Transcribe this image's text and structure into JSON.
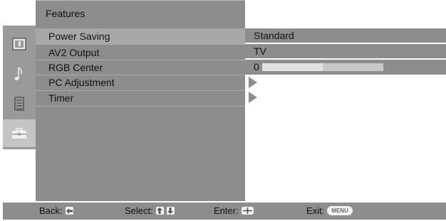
{
  "header": {
    "title": "Features"
  },
  "sidebar": {
    "tabs": [
      {
        "icon": "picture-icon",
        "active": false
      },
      {
        "icon": "music-note-icon",
        "active": false
      },
      {
        "icon": "channel-list-icon",
        "active": false
      },
      {
        "icon": "toolbox-icon",
        "active": true
      }
    ]
  },
  "menu": {
    "items": [
      {
        "label": "Power Saving",
        "value": "Standard"
      },
      {
        "label": "AV2 Output",
        "value": "TV"
      },
      {
        "label": "RGB Center",
        "value": "0",
        "level": 0.5
      },
      {
        "label": "PC Adjustment",
        "has_submenu": true
      },
      {
        "label": "Timer",
        "has_submenu": true
      }
    ]
  },
  "footer": {
    "back_label": "Back:",
    "select_label": "Select:",
    "enter_label": "Enter:",
    "exit_label": "Exit:",
    "exit_key": "MENU"
  },
  "colors": {
    "panel": "#8d8d8d",
    "sidebar": "#9a9a9a",
    "selected": "#a8a8a8",
    "key": "#f2f2f2"
  }
}
